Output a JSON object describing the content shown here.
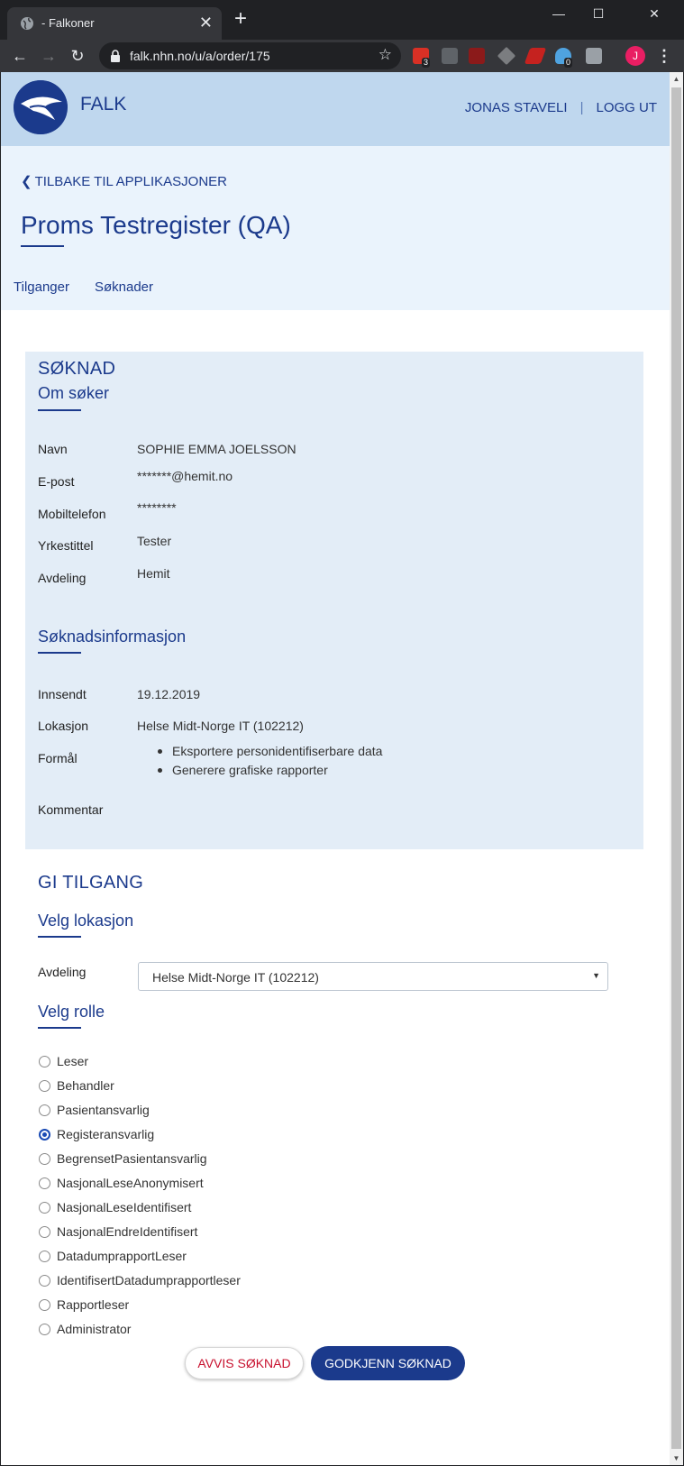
{
  "browser": {
    "tab_title": "- Falkoner",
    "url": "falk.nhn.no/u/a/order/175",
    "profile_initial": "J",
    "extension_badges": [
      "3",
      "0"
    ]
  },
  "header": {
    "app_name": "FALK",
    "user_name": "JONAS STAVELI",
    "separator": "|",
    "logout": "LOGG UT"
  },
  "subheader": {
    "back_link": "TILBAKE TIL APPLIKASJONER",
    "title": "Proms Testregister (QA)",
    "tabs": [
      "Tilganger",
      "Søknader"
    ]
  },
  "application": {
    "heading": "SØKNAD",
    "applicant_heading": "Om søker",
    "applicant": [
      {
        "label": "Navn",
        "value": "SOPHIE EMMA JOELSSON"
      },
      {
        "label": "E-post",
        "value": "*******@hemit.no"
      },
      {
        "label": "Mobiltelefon",
        "value": "********"
      },
      {
        "label": "Yrkestittel",
        "value": "Tester"
      },
      {
        "label": "Avdeling",
        "value": "Hemit"
      }
    ],
    "info_heading": "Søknadsinformasjon",
    "submitted_label": "Innsendt",
    "submitted_value": "19.12.2019",
    "location_label": "Lokasjon",
    "location_value": "Helse Midt-Norge IT (102212)",
    "purpose_label": "Formål",
    "purposes": [
      "Eksportere personidentifiserbare data",
      "Generere grafiske rapporter"
    ],
    "comment_label": "Kommentar"
  },
  "grant": {
    "heading": "GI TILGANG",
    "location_heading": "Velg lokasjon",
    "department_label": "Avdeling",
    "department_selected": "Helse Midt-Norge IT (102212)",
    "role_heading": "Velg rolle",
    "roles": [
      "Leser",
      "Behandler",
      "Pasientansvarlig",
      "Registeransvarlig",
      "BegrensetPasientansvarlig",
      "NasjonalLeseAnonymisert",
      "NasjonalLeseIdentifisert",
      "NasjonalEndreIdentifisert",
      "DatadumprapportLeser",
      "IdentifisertDatadumprapportleser",
      "Rapportleser",
      "Administrator"
    ],
    "selected_role": "Registeransvarlig"
  },
  "actions": {
    "reject": "AVVIS SØKNAD",
    "approve": "GODKJENN SØKNAD"
  },
  "colors": {
    "brand_blue": "#1b3a8c",
    "header_bg": "#bfd7ee",
    "subheader_bg": "#eaf3fc",
    "card_bg": "#e3edf7",
    "reject_red": "#c8102e"
  }
}
